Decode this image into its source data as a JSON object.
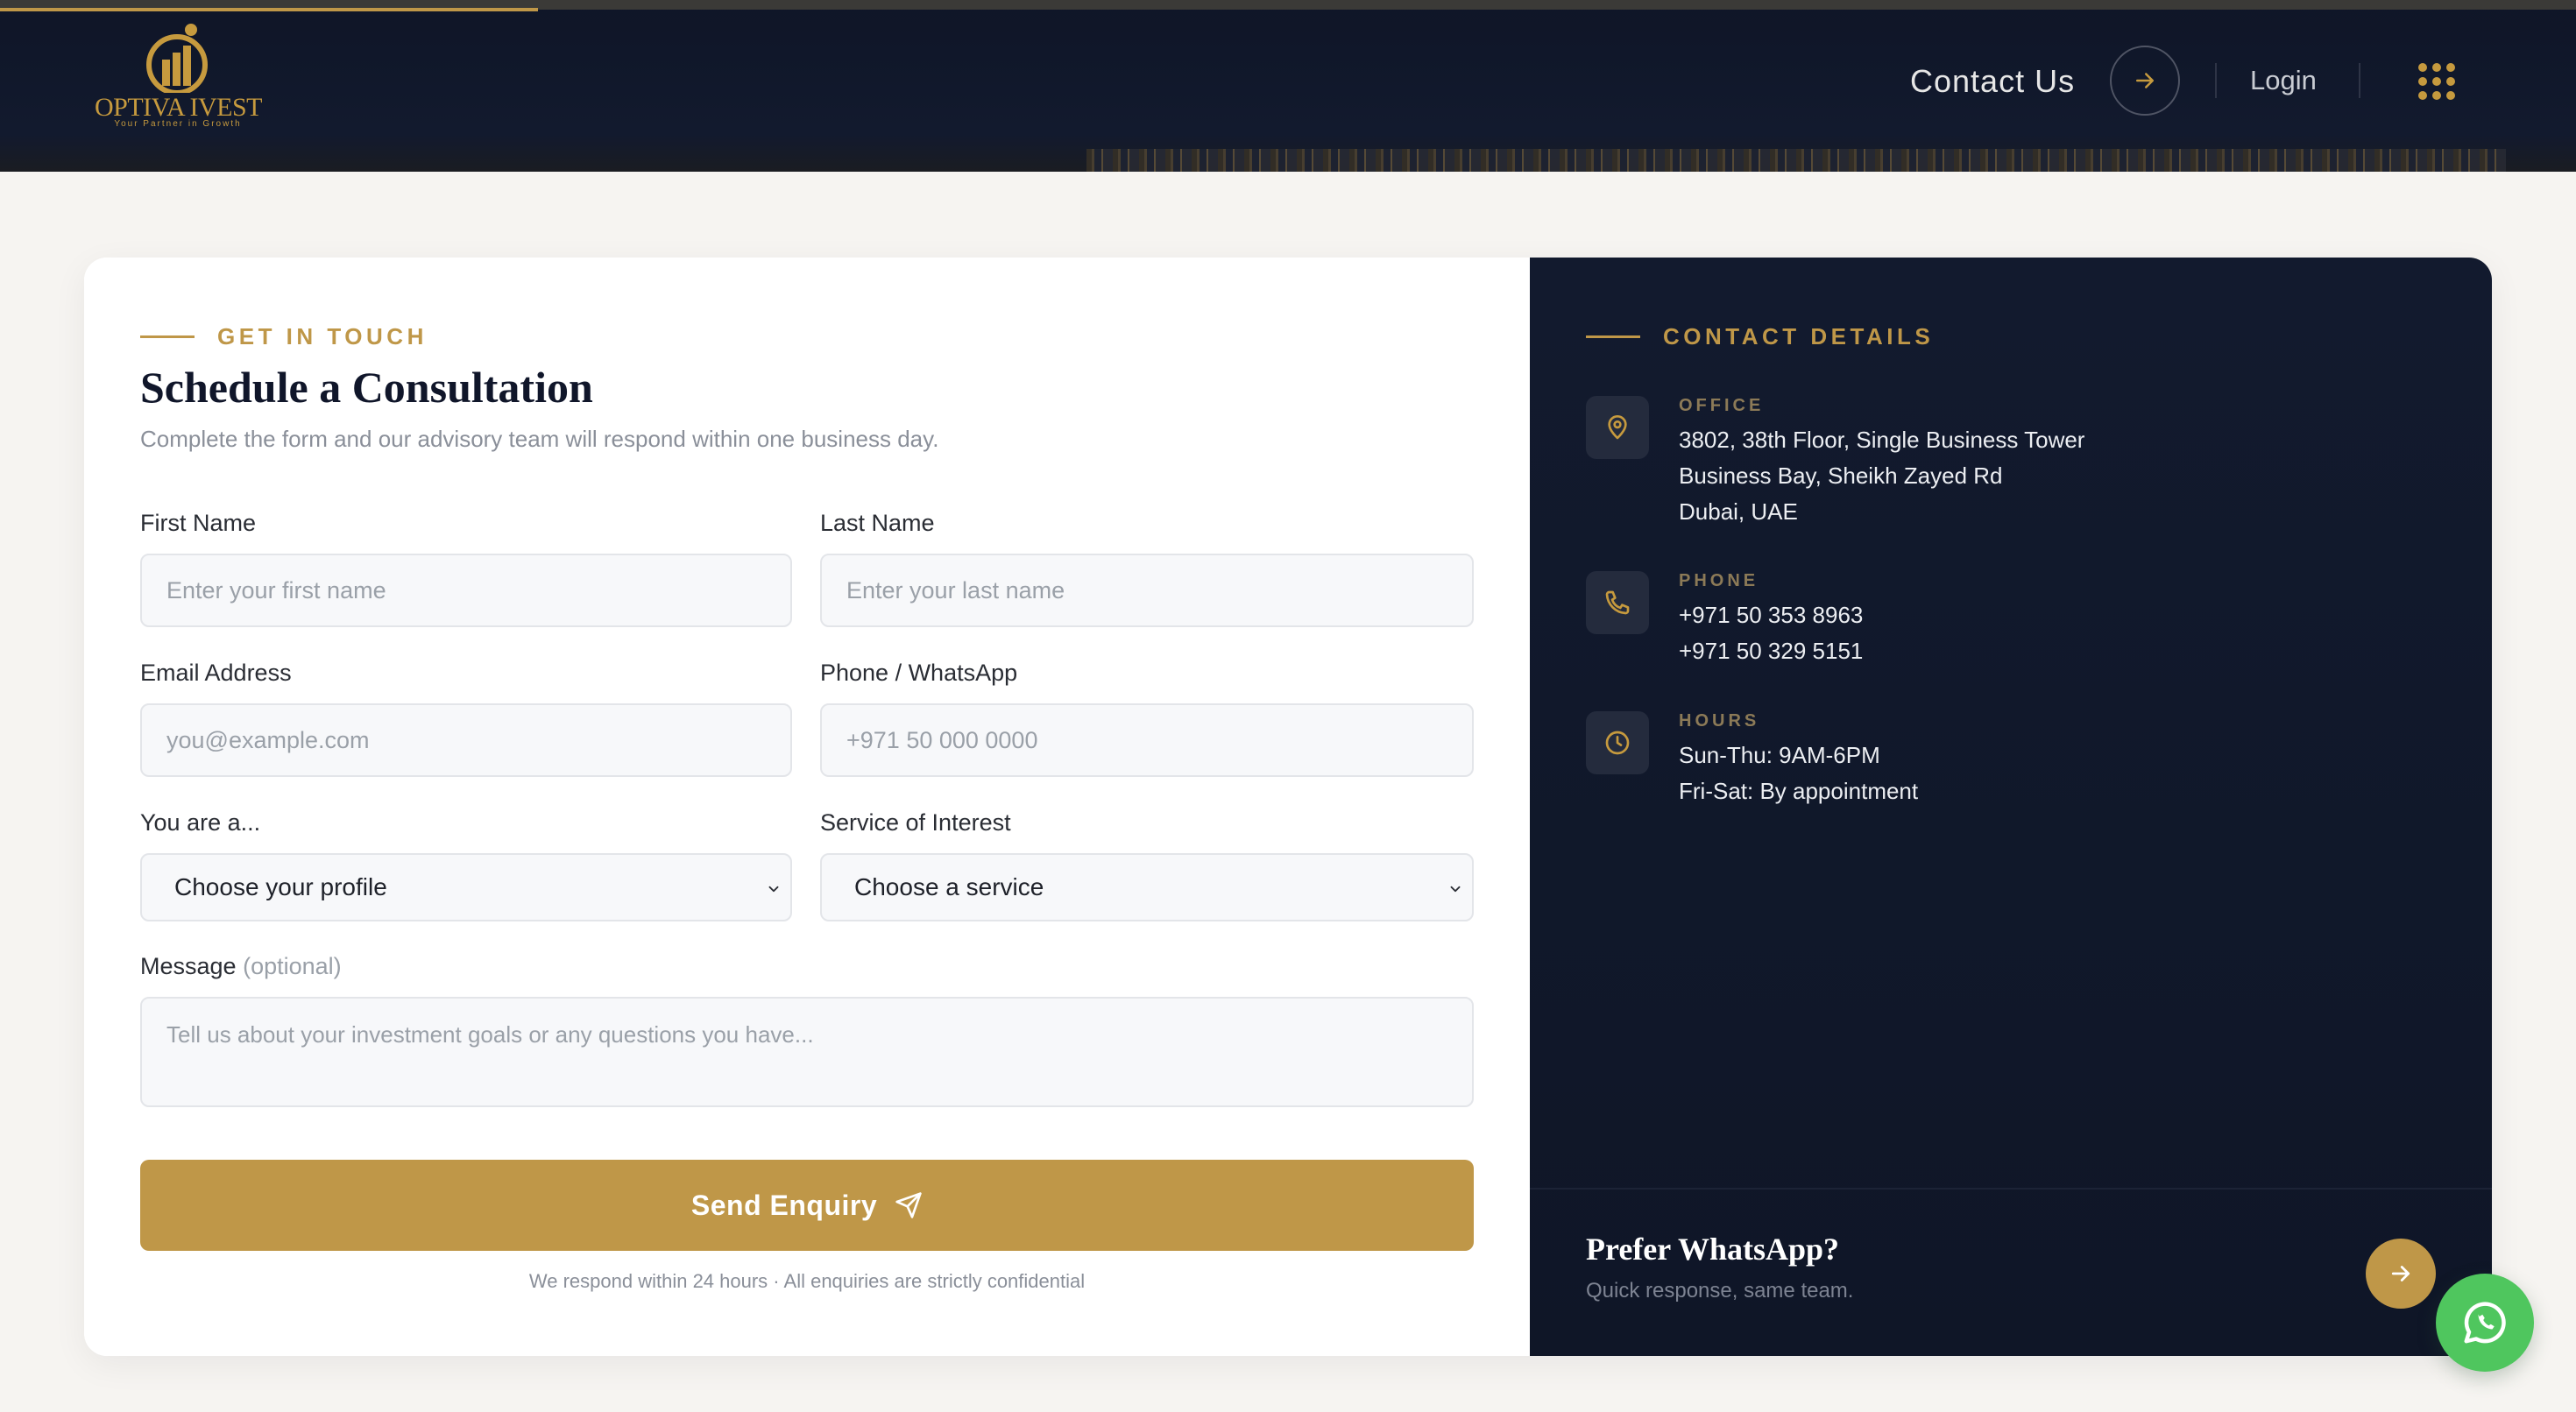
{
  "header": {
    "brand": {
      "name": "OPTIVA IVEST",
      "tagline": "Your Partner in Growth"
    },
    "contact_label": "Contact Us",
    "login_label": "Login",
    "icons": [
      "arrow-right-icon",
      "apps-grid-icon"
    ]
  },
  "form": {
    "eyebrow": "GET IN TOUCH",
    "title": "Schedule a Consultation",
    "subtitle": "Complete the form and our advisory team will respond within one business day.",
    "first_name": {
      "label": "First Name",
      "placeholder": "Enter your first name"
    },
    "last_name": {
      "label": "Last Name",
      "placeholder": "Enter your last name"
    },
    "email": {
      "label": "Email Address",
      "placeholder": "you@example.com"
    },
    "phone": {
      "label": "Phone / WhatsApp",
      "placeholder": "+971 50 000 0000"
    },
    "profile": {
      "label": "You are a...",
      "value": "Choose your profile"
    },
    "service": {
      "label": "Service of Interest",
      "value": "Choose a service"
    },
    "message": {
      "label": "Message",
      "optional": "(optional)",
      "placeholder": "Tell us about your investment goals or any questions you have..."
    },
    "submit_label": "Send Enquiry",
    "note": "We respond within 24 hours · All enquiries are strictly confidential"
  },
  "contact": {
    "eyebrow": "CONTACT DETAILS",
    "office": {
      "heading": "OFFICE",
      "lines": [
        "3802, 38th Floor, Single Business Tower",
        "Business Bay, Sheikh Zayed Rd",
        "Dubai, UAE"
      ]
    },
    "phone": {
      "heading": "PHONE",
      "lines": [
        "+971 50 353 8963",
        "+971 50 329 5151"
      ]
    },
    "hours": {
      "heading": "HOURS",
      "lines": [
        "Sun-Thu: 9AM-6PM",
        "Fri-Sat: By appointment"
      ]
    },
    "whatsapp": {
      "title": "Prefer WhatsApp?",
      "subtitle": "Quick response, same team."
    }
  },
  "colors": {
    "accent": "#bf9748",
    "navy": "#121a2e",
    "whatsapp": "#4fc65e"
  }
}
